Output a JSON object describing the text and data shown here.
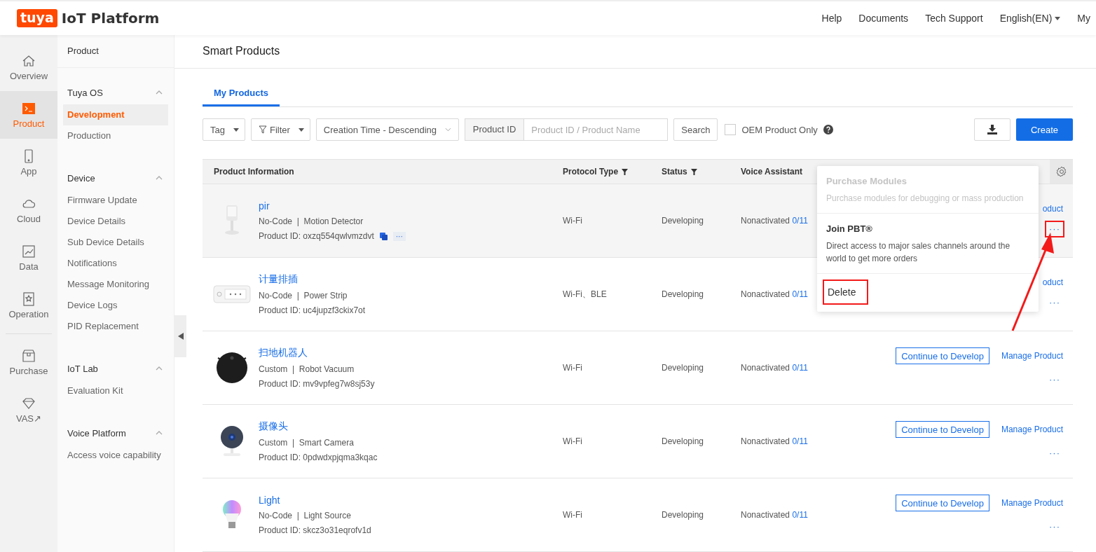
{
  "header": {
    "logo_badge": "tuya",
    "logo_text": "IoT Platform",
    "nav": [
      {
        "label": "Help",
        "dropdown": false
      },
      {
        "label": "Documents",
        "dropdown": false
      },
      {
        "label": "Tech Support",
        "dropdown": false
      },
      {
        "label": "English(EN)",
        "dropdown": true
      },
      {
        "label": "My",
        "dropdown": false
      }
    ]
  },
  "rail": [
    {
      "kind": "item",
      "label": "Overview",
      "selected": false
    },
    {
      "kind": "item",
      "label": "Product",
      "selected": true
    },
    {
      "kind": "item",
      "label": "App",
      "selected": false
    },
    {
      "kind": "item",
      "label": "Cloud",
      "selected": false
    },
    {
      "kind": "item",
      "label": "Data",
      "selected": false
    },
    {
      "kind": "item",
      "label": "Operation",
      "selected": false
    },
    {
      "kind": "divider"
    },
    {
      "kind": "item",
      "label": "Purchase",
      "selected": false
    },
    {
      "kind": "item",
      "label": "VAS↗",
      "selected": false
    }
  ],
  "sidebar": {
    "title": "Product",
    "groups": [
      {
        "label": "Tuya OS",
        "expanded": true,
        "items": [
          {
            "label": "Development",
            "selected": true
          },
          {
            "label": "Production",
            "selected": false
          }
        ]
      },
      {
        "label": "Device",
        "expanded": true,
        "items": [
          {
            "label": "Firmware Update",
            "selected": false
          },
          {
            "label": "Device Details",
            "selected": false
          },
          {
            "label": "Sub Device Details",
            "selected": false
          },
          {
            "label": "Notifications",
            "selected": false
          },
          {
            "label": "Message Monitoring",
            "selected": false
          },
          {
            "label": "Device Logs",
            "selected": false
          },
          {
            "label": "PID Replacement",
            "selected": false
          }
        ]
      },
      {
        "label": "IoT Lab",
        "expanded": true,
        "items": [
          {
            "label": "Evaluation Kit",
            "selected": false
          }
        ]
      },
      {
        "label": "Voice Platform",
        "expanded": true,
        "items": [
          {
            "label": "Access voice capability",
            "selected": false
          }
        ]
      }
    ]
  },
  "page": {
    "title": "Smart Products",
    "tabs": [
      {
        "label": "My Products",
        "selected": true
      }
    ]
  },
  "toolbar": {
    "tag": "Tag",
    "filter": "Filter",
    "sort": "Creation Time - Descending",
    "search_scope": "Product ID",
    "search_placeholder": "Product ID / Product Name",
    "search_button": "Search",
    "oem": {
      "label": "OEM Product Only",
      "checked": false
    },
    "create": "Create"
  },
  "table": {
    "columns": [
      {
        "label": "Product Information",
        "filter": false
      },
      {
        "label": "Protocol Type",
        "filter": true
      },
      {
        "label": "Status",
        "filter": true
      },
      {
        "label": "Voice Assistant",
        "filter": false
      }
    ],
    "rows": [
      {
        "name": "pir",
        "type_line": "No-Code  |  Motion Detector",
        "product_id": "Product ID: oxzq554qwlvmzdvt",
        "id_tools": true,
        "id_more": "···",
        "protocol": "Wi-Fi",
        "status": "Developing",
        "voice_state": "Nonactivated",
        "voice_count": "0/11",
        "manage_link": "oduct",
        "more": "···",
        "hovered": true,
        "more_highlighted": true
      },
      {
        "name": "计量排插",
        "type_line": "No-Code  |  Power Strip",
        "product_id": "Product ID: uc4jupzf3ckix7ot",
        "id_tools": false,
        "protocol": "Wi-Fi、BLE",
        "status": "Developing",
        "voice_state": "Nonactivated",
        "voice_count": "0/11",
        "manage_link": "oduct",
        "more": "···",
        "hovered": false,
        "more_highlighted": false
      },
      {
        "name": "扫地机器人",
        "type_line": "Custom  |  Robot Vacuum",
        "product_id": "Product ID: mv9vpfeg7w8sj53y",
        "id_tools": false,
        "protocol": "Wi-Fi",
        "status": "Developing",
        "voice_state": "Nonactivated",
        "voice_count": "0/11",
        "continue_button": "Continue to Develop",
        "manage_link": "Manage Product",
        "more": "···",
        "hovered": false,
        "more_highlighted": false
      },
      {
        "name": "摄像头",
        "type_line": "Custom  |  Smart Camera",
        "product_id": "Product ID: 0pdwdxpjqma3kqac",
        "id_tools": false,
        "protocol": "Wi-Fi",
        "status": "Developing",
        "voice_state": "Nonactivated",
        "voice_count": "0/11",
        "continue_button": "Continue to Develop",
        "manage_link": "Manage Product",
        "more": "···",
        "hovered": false,
        "more_highlighted": false
      },
      {
        "name": "Light",
        "type_line": "No-Code  |  Light Source",
        "product_id": "Product ID: skcz3o31eqrofv1d",
        "id_tools": false,
        "protocol": "Wi-Fi",
        "status": "Developing",
        "voice_state": "Nonactivated",
        "voice_count": "0/11",
        "continue_button": "Continue to Develop",
        "manage_link": "Manage Product",
        "more": "···",
        "hovered": false,
        "more_highlighted": false
      }
    ]
  },
  "menu": {
    "items": [
      {
        "title": "Purchase Modules",
        "description": "Purchase modules for debugging or mass production",
        "disabled": true
      },
      {
        "title": "Join PBT®",
        "description": "Direct access to major sales channels around the world to get more orders",
        "disabled": false
      },
      {
        "title": "Delete",
        "disabled": false,
        "highlighted": true
      }
    ]
  },
  "annotation_arrow": true
}
